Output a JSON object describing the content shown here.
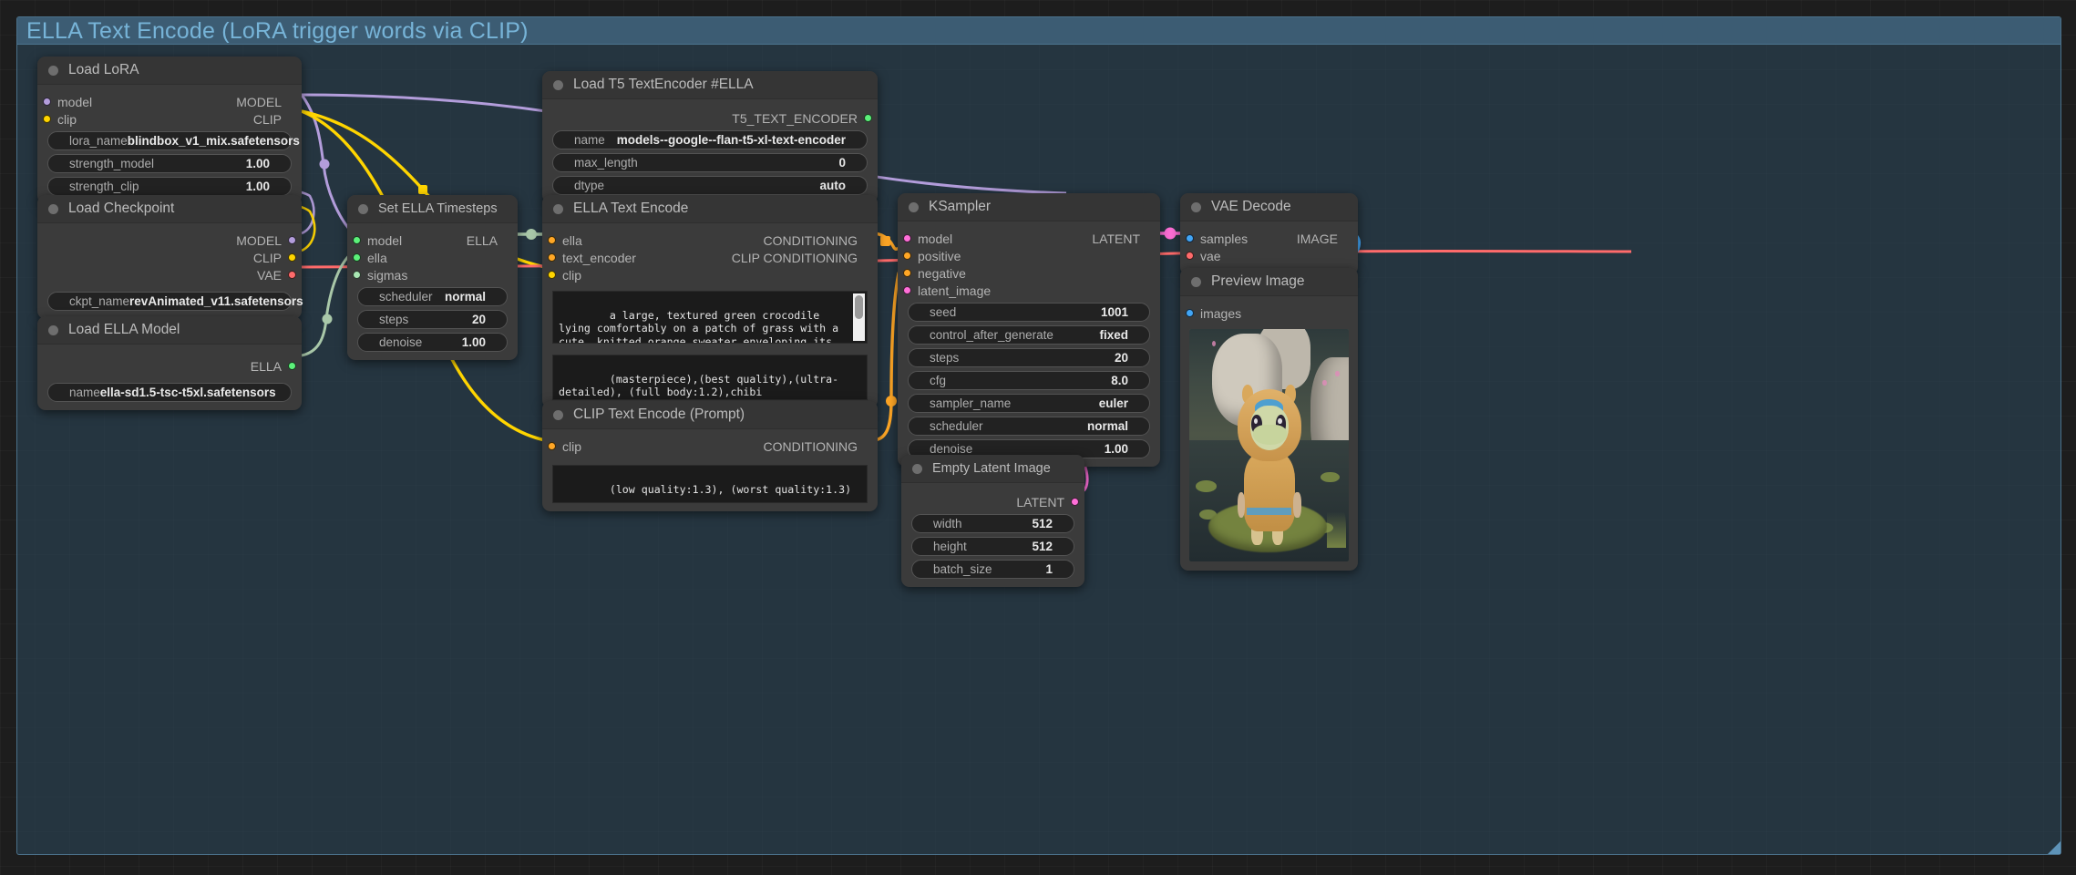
{
  "group": {
    "title": "ELLA Text Encode (LoRA trigger words via CLIP)",
    "color": "#3e5f77",
    "text_color": "#77b4d8"
  },
  "nodes": {
    "load_lora": {
      "title": "Load LoRA",
      "inputs": [
        {
          "name": "model",
          "color": "#b39ddb"
        },
        {
          "name": "clip",
          "color": "#ffd500"
        }
      ],
      "outputs": [
        {
          "name": "MODEL",
          "color": "#b39ddb"
        },
        {
          "name": "CLIP",
          "color": "#ffd500"
        }
      ],
      "widgets": [
        {
          "label": "lora_name",
          "value": "blindbox_v1_mix.safetensors"
        },
        {
          "label": "strength_model",
          "value": "1.00"
        },
        {
          "label": "strength_clip",
          "value": "1.00"
        }
      ]
    },
    "load_checkpoint": {
      "title": "Load Checkpoint",
      "inputs": [],
      "outputs": [
        {
          "name": "MODEL",
          "color": "#b39ddb"
        },
        {
          "name": "CLIP",
          "color": "#ffd500"
        },
        {
          "name": "VAE",
          "color": "#ff6b6b"
        }
      ],
      "widgets": [
        {
          "label": "ckpt_name",
          "value": "revAnimated_v11.safetensors"
        }
      ]
    },
    "load_ella_model": {
      "title": "Load ELLA Model",
      "inputs": [],
      "outputs": [
        {
          "name": "ELLA",
          "color": "#5cf07a"
        }
      ],
      "widgets": [
        {
          "label": "name",
          "value": "ella-sd1.5-tsc-t5xl.safetensors"
        }
      ]
    },
    "set_ella_timesteps": {
      "title": "Set ELLA Timesteps",
      "inputs": [
        {
          "name": "model",
          "color": "#b39ddb"
        },
        {
          "name": "ella",
          "color": "#5cf07a"
        },
        {
          "name": "sigmas",
          "color": "#a9e7b4"
        }
      ],
      "outputs": [
        {
          "name": "ELLA",
          "color": "#5cf07a"
        }
      ],
      "widgets": [
        {
          "label": "scheduler",
          "value": "normal"
        },
        {
          "label": "steps",
          "value": "20"
        },
        {
          "label": "denoise",
          "value": "1.00"
        }
      ]
    },
    "load_t5": {
      "title": "Load T5 TextEncoder #ELLA",
      "inputs": [],
      "outputs": [
        {
          "name": "T5_TEXT_ENCODER",
          "color": "#5cf07a"
        }
      ],
      "widgets": [
        {
          "label": "name",
          "value": "models--google--flan-t5-xl-text-encoder"
        },
        {
          "label": "max_length",
          "value": "0"
        },
        {
          "label": "dtype",
          "value": "auto"
        }
      ]
    },
    "ella_text_encode": {
      "title": "ELLA Text Encode",
      "inputs": [
        {
          "name": "ella",
          "color": "#5cf07a"
        },
        {
          "name": "text_encoder",
          "color": "#5cf07a"
        },
        {
          "name": "clip",
          "color": "#ffd500"
        }
      ],
      "outputs": [
        {
          "name": "CONDITIONING",
          "color": "#ffa726"
        },
        {
          "name": "CLIP CONDITIONING",
          "color": "#ffa726"
        }
      ],
      "text_primary": "a large, textured green crocodile lying comfortably on a patch of grass with a cute, knitted orange sweater enveloping its scaly body. Around its neck, the sweater features a whimsical pattern of blue and yellow stripes. In",
      "text_secondary": "(masterpiece),(best quality),(ultra-detailed), (full body:1.2),chibi"
    },
    "clip_text_encode": {
      "title": "CLIP Text Encode (Prompt)",
      "inputs": [
        {
          "name": "clip",
          "color": "#ffd500"
        }
      ],
      "outputs": [
        {
          "name": "CONDITIONING",
          "color": "#ffa726"
        }
      ],
      "text": "(low quality:1.3), (worst quality:1.3)"
    },
    "ksampler": {
      "title": "KSampler",
      "inputs": [
        {
          "name": "model",
          "color": "#b39ddb"
        },
        {
          "name": "positive",
          "color": "#ffa726"
        },
        {
          "name": "negative",
          "color": "#ffa726"
        },
        {
          "name": "latent_image",
          "color": "#ff6fd8"
        }
      ],
      "outputs": [
        {
          "name": "LATENT",
          "color": "#ff6fd8"
        }
      ],
      "widgets": [
        {
          "label": "seed",
          "value": "1001"
        },
        {
          "label": "control_after_generate",
          "value": "fixed"
        },
        {
          "label": "steps",
          "value": "20"
        },
        {
          "label": "cfg",
          "value": "8.0"
        },
        {
          "label": "sampler_name",
          "value": "euler"
        },
        {
          "label": "scheduler",
          "value": "normal"
        },
        {
          "label": "denoise",
          "value": "1.00"
        }
      ]
    },
    "empty_latent": {
      "title": "Empty Latent Image",
      "inputs": [],
      "outputs": [
        {
          "name": "LATENT",
          "color": "#ff6fd8"
        }
      ],
      "widgets": [
        {
          "label": "width",
          "value": "512"
        },
        {
          "label": "height",
          "value": "512"
        },
        {
          "label": "batch_size",
          "value": "1"
        }
      ]
    },
    "vae_decode": {
      "title": "VAE Decode",
      "inputs": [
        {
          "name": "samples",
          "color": "#ff6fd8"
        },
        {
          "name": "vae",
          "color": "#ff6b6b"
        }
      ],
      "outputs": [
        {
          "name": "IMAGE",
          "color": "#42a5f5"
        }
      ],
      "widgets": []
    },
    "preview_image": {
      "title": "Preview Image",
      "inputs": [
        {
          "name": "images",
          "color": "#42a5f5"
        }
      ],
      "outputs": [],
      "widgets": []
    }
  },
  "link_colors": {
    "MODEL": "#b39ddb",
    "CLIP": "#ffd500",
    "VAE": "#ff6b6b",
    "ELLA": "#a9c8a9",
    "CONDITIONING": "#ffa726",
    "LATENT": "#ff6fd8",
    "IMAGE": "#42a5f5"
  }
}
